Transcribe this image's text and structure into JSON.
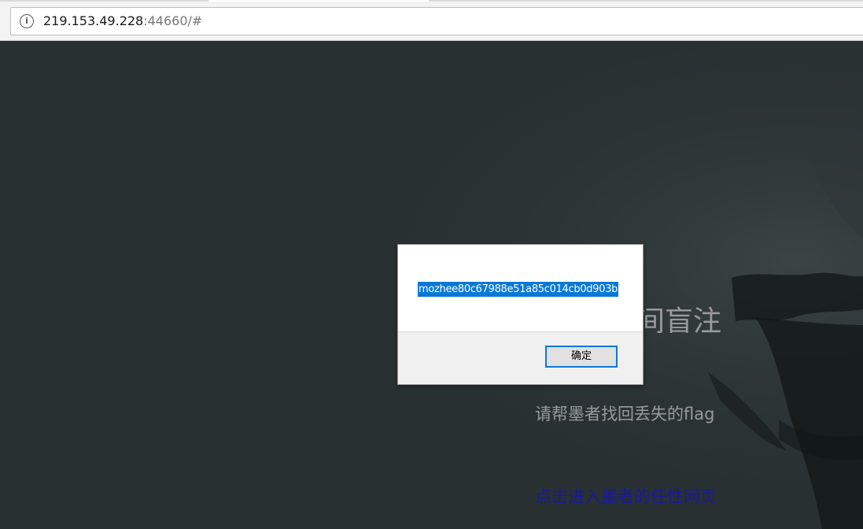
{
  "browser": {
    "url_host": "219.153.49.228",
    "url_rest": ":44660/#"
  },
  "page": {
    "heading": "间盲注",
    "subtitle": "请帮墨者找回丢失的flag",
    "link": "点击进入墨者的任性网页"
  },
  "dialog": {
    "message": "mozhee80c67988e51a85c014cb0d903b",
    "ok_label": "确定",
    "accent": "#0a78d7"
  },
  "colors": {
    "background": "#283031",
    "text_muted": "#9a9a9a",
    "link": "#1a1a9c"
  }
}
